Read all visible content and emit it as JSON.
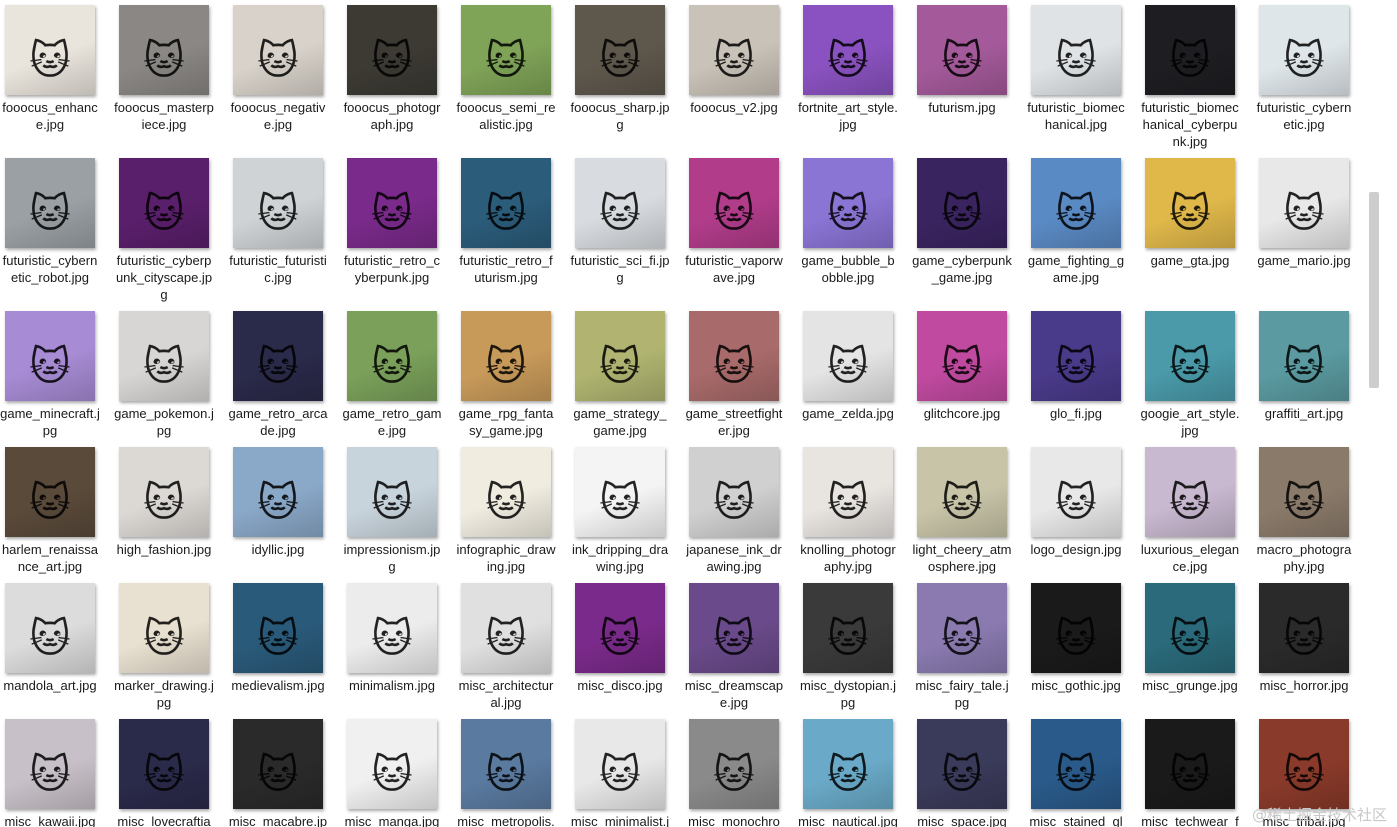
{
  "rows": [
    [
      "fooocus_enhance.jpg",
      "fooocus_masterpiece.jpg",
      "fooocus_negative.jpg",
      "fooocus_photograph.jpg",
      "fooocus_semi_realistic.jpg",
      "fooocus_sharp.jpg",
      "fooocus_v2.jpg",
      "fortnite_art_style.jpg",
      "futurism.jpg",
      "futuristic_biomechanical.jpg",
      "futuristic_biomechanical_cyberpunk.jpg",
      "futuristic_cybernetic.jpg"
    ],
    [
      "futuristic_cybernetic_robot.jpg",
      "futuristic_cyberpunk_cityscape.jpg",
      "futuristic_futuristic.jpg",
      "futuristic_retro_cyberpunk.jpg",
      "futuristic_retro_futurism.jpg",
      "futuristic_sci_fi.jpg",
      "futuristic_vaporwave.jpg",
      "game_bubble_bobble.jpg",
      "game_cyberpunk_game.jpg",
      "game_fighting_game.jpg",
      "game_gta.jpg",
      "game_mario.jpg"
    ],
    [
      "game_minecraft.jpg",
      "game_pokemon.jpg",
      "game_retro_arcade.jpg",
      "game_retro_game.jpg",
      "game_rpg_fantasy_game.jpg",
      "game_strategy_game.jpg",
      "game_streetfighter.jpg",
      "game_zelda.jpg",
      "glitchcore.jpg",
      "glo_fi.jpg",
      "googie_art_style.jpg",
      "graffiti_art.jpg"
    ],
    [
      "harlem_renaissance_art.jpg",
      "high_fashion.jpg",
      "idyllic.jpg",
      "impressionism.jpg",
      "infographic_drawing.jpg",
      "ink_dripping_drawing.jpg",
      "japanese_ink_drawing.jpg",
      "knolling_photography.jpg",
      "light_cheery_atmosphere.jpg",
      "logo_design.jpg",
      "luxurious_elegance.jpg",
      "macro_photography.jpg"
    ],
    [
      "mandola_art.jpg",
      "marker_drawing.jpg",
      "medievalism.jpg",
      "minimalism.jpg",
      "misc_architectural.jpg",
      "misc_disco.jpg",
      "misc_dreamscape.jpg",
      "misc_dystopian.jpg",
      "misc_fairy_tale.jpg",
      "misc_gothic.jpg",
      "misc_grunge.jpg",
      "misc_horror.jpg"
    ],
    [
      "misc_kawaii.jpg",
      "misc_lovecraftian.jpg",
      "misc_macabre.jpg",
      "misc_manga.jpg",
      "misc_metropolis.jpg",
      "misc_minimalist.jpg",
      "misc_monochrome.jpg",
      "misc_nautical.jpg",
      "misc_space.jpg",
      "misc_stained_glass.jpg",
      "misc_techwear_fashion.jpg",
      "misc_tribal.jpg"
    ]
  ],
  "thumb_colors": [
    [
      "#e9e4dc",
      "#8a8784",
      "#d8d2ca",
      "#3c3a33",
      "#7fa357",
      "#5e574c",
      "#c9c2b8",
      "#8a52c0",
      "#a45a9a",
      "#dfe3e6",
      "#1e1e22",
      "#dfe6ea"
    ],
    [
      "#9aa0a4",
      "#5a1f6b",
      "#cfd3d6",
      "#7a2a8a",
      "#2b5c7a",
      "#d8dce0",
      "#b13c8a",
      "#8a74d4",
      "#3a2460",
      "#5a8ac4",
      "#e0b84a",
      "#e8e8e8"
    ],
    [
      "#a78bd4",
      "#d8d6d4",
      "#2a2a4a",
      "#7aa05a",
      "#c89a5a",
      "#b0b470",
      "#a86a6a",
      "#e4e4e4",
      "#c04aa0",
      "#4a3a8a",
      "#4a9aaa",
      "#5a9aa0"
    ],
    [
      "#5a4a3a",
      "#dcd8d4",
      "#8aa8c8",
      "#c8d4dc",
      "#f0ece0",
      "#f4f4f4",
      "#d0d0d0",
      "#e8e4e0",
      "#c8c4a8",
      "#e8e8e8",
      "#c8b8d0",
      "#8a7a6a"
    ],
    [
      "#dcdcdc",
      "#e8e0d0",
      "#2a5a7a",
      "#ececec",
      "#e0e0e0",
      "#7a2a8a",
      "#6a4a8a",
      "#3a3a3a",
      "#8a7ab0",
      "#1a1a1a",
      "#2a6a7a",
      "#2a2a2a"
    ],
    [
      "#c8c0c8",
      "#2a2a4a",
      "#2a2a2a",
      "#f0f0f0",
      "#5a7aa0",
      "#e8e8e8",
      "#8a8a8a",
      "#6aaac8",
      "#3a3a5a",
      "#2a5a8a",
      "#1a1a1a",
      "#8a3a2a"
    ]
  ],
  "icons": {
    "thumbnail": "cat-image-icon"
  },
  "scrollbar": {
    "color": "#cdcdcd"
  },
  "watermark": "@稀土掘金技术社区"
}
